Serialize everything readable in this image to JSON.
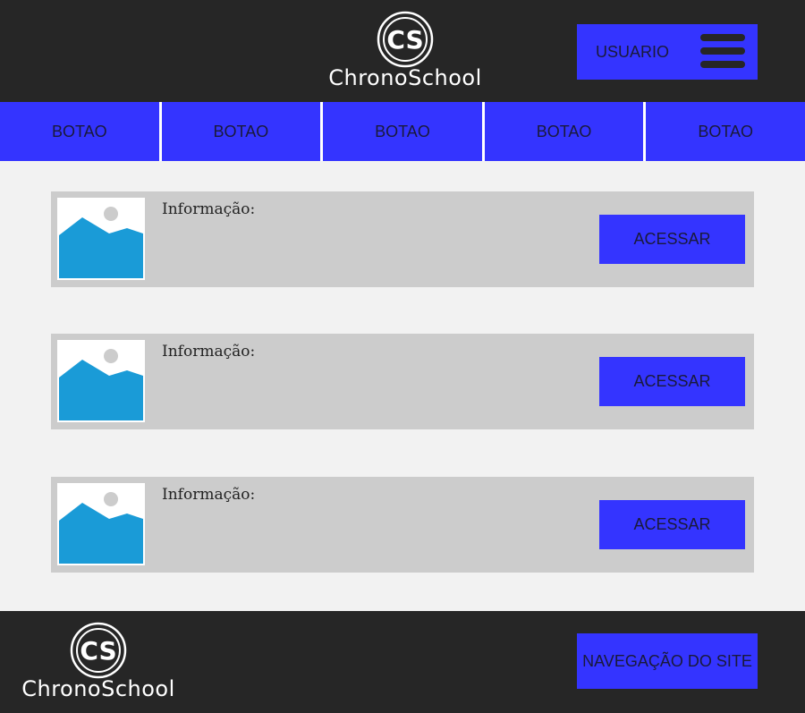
{
  "header": {
    "logo_mark": "CS",
    "logo_name": "ChronoSchool",
    "user_label": "USUARIO"
  },
  "nav": {
    "items": [
      "BOTAO",
      "BOTAO",
      "BOTAO",
      "BOTAO",
      "BOTAO"
    ]
  },
  "cards": [
    {
      "info_label": "Informação:",
      "button_label": "ACESSAR"
    },
    {
      "info_label": "Informação:",
      "button_label": "ACESSAR"
    },
    {
      "info_label": "Informação:",
      "button_label": "ACESSAR"
    }
  ],
  "footer": {
    "logo_mark": "CS",
    "logo_name": "ChronoSchool",
    "nav_label": "NAVEGAÇÃO DO SITE"
  },
  "colors": {
    "accent": "#3434ff",
    "dark": "#262626",
    "card_bg": "#cccccc",
    "page_bg": "#f2f2f2",
    "image_fill": "#1a9bd7"
  },
  "icons": {
    "thumbnail": "image-placeholder-icon",
    "menu": "hamburger-menu-icon"
  }
}
